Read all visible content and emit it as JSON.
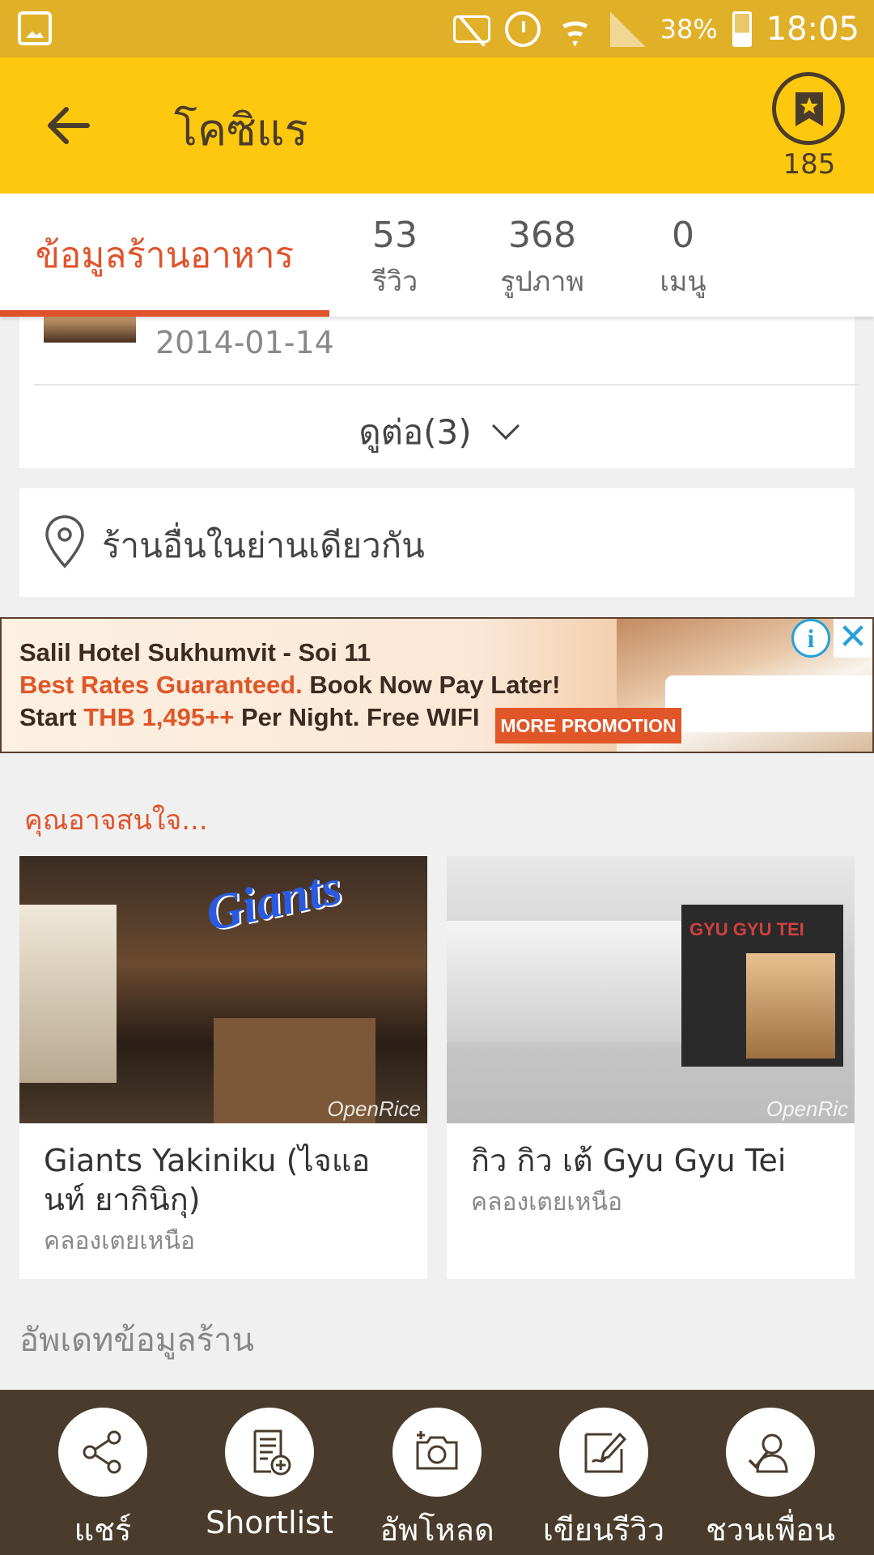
{
  "status_bar": {
    "battery": "38%",
    "time": "18:05"
  },
  "header": {
    "title": "โคซิแร",
    "bookmark_count": "185"
  },
  "tabs": {
    "info_label": "ข้อมูลร้านอาหาร",
    "stats": [
      {
        "count": "53",
        "label": "รีวิว"
      },
      {
        "count": "368",
        "label": "รูปภาพ"
      },
      {
        "count": "0",
        "label": "เมนู"
      }
    ]
  },
  "review": {
    "date": "2014-01-14",
    "see_more": "ดูต่อ(3)"
  },
  "nearby": {
    "label": "ร้านอื่นในย่านเดียวกัน"
  },
  "ad": {
    "line1": "Salil Hotel Sukhumvit  - Soi 11",
    "line2_highlight": "Best Rates Guaranteed.",
    "line2_rest": " Book Now Pay Later!",
    "line3_start": "Start ",
    "line3_highlight": "THB 1,495++",
    "line3_end": " Per Night. Free WIFI",
    "promo_button": "MORE PROMOTION"
  },
  "suggestions": {
    "heading": "คุณอาจสนใจ...",
    "items": [
      {
        "name": "Giants Yakiniku (ไจแอนท์ ยากินิกุ)",
        "area": "คลองเตยเหนือ",
        "photo_sign": "Giants",
        "watermark": "OpenRice"
      },
      {
        "name": "กิว กิว เต้ Gyu Gyu Tei",
        "area": "คลองเตยเหนือ",
        "photo_sign": "GYU GYU TEI",
        "watermark": "OpenRic"
      }
    ]
  },
  "update_heading": "อัพเดทข้อมูลร้าน",
  "actions": [
    {
      "label": "แชร์",
      "icon": "share-icon"
    },
    {
      "label": "Shortlist",
      "icon": "shortlist-icon"
    },
    {
      "label": "อัพโหลด",
      "icon": "camera-icon"
    },
    {
      "label": "เขียนรีวิว",
      "icon": "write-review-icon"
    },
    {
      "label": "ชวนเพื่อน",
      "icon": "invite-friend-icon"
    }
  ],
  "colors": {
    "app_bar": "#fdc80e",
    "status_bar": "#e0b028",
    "accent": "#e0532a",
    "action_bar": "#4a3c2c"
  }
}
